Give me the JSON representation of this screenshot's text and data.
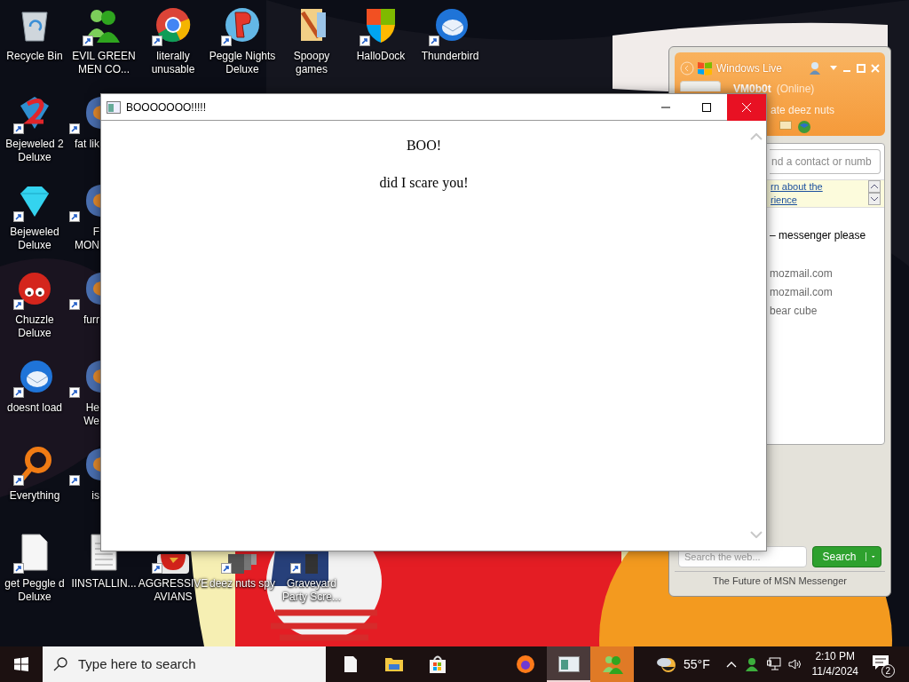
{
  "desktop": {
    "left_columns": [
      [
        {
          "lines": [
            "Recycle Bin"
          ],
          "shortcut": false
        },
        {
          "lines": [
            "Bejeweled 2",
            "Deluxe"
          ],
          "shortcut": true
        },
        {
          "lines": [
            "Bejeweled",
            "Deluxe"
          ],
          "shortcut": true
        },
        {
          "lines": [
            "Chuzzle",
            "Deluxe"
          ],
          "shortcut": true
        },
        {
          "lines": [
            "doesnt load"
          ],
          "shortcut": true
        },
        {
          "lines": [
            "Everything"
          ],
          "shortcut": true
        },
        {
          "lines": [
            "get Peggle d",
            "Deluxe"
          ],
          "shortcut": true
        }
      ],
      [
        {
          "lines": [
            "EVIL GREEN",
            "MEN CO..."
          ],
          "shortcut": true
        },
        {
          "lines": [
            "fat lik"
          ],
          "shortcut": true
        },
        {
          "lines": [
            "F",
            "MON"
          ],
          "shortcut": true
        },
        {
          "lines": [
            "furr"
          ],
          "shortcut": true
        },
        {
          "lines": [
            "He",
            "We"
          ],
          "shortcut": true
        },
        {
          "lines": [
            "is"
          ],
          "shortcut": true
        },
        {
          "lines": [
            "IINSTALLIN..."
          ],
          "shortcut": false
        }
      ]
    ],
    "top_row": [
      {
        "lines": [
          "literally",
          "unusable"
        ],
        "shortcut": true
      },
      {
        "lines": [
          "Peggle Nights",
          "Deluxe"
        ],
        "shortcut": true
      },
      {
        "lines": [
          "Spoopy",
          "games"
        ],
        "shortcut": false
      },
      {
        "lines": [
          "HalloDock"
        ],
        "shortcut": true
      },
      {
        "lines": [
          "Thunderbird"
        ],
        "shortcut": true
      }
    ],
    "bottom_row": [
      {
        "lines": [
          "AGGRESSIVE",
          "AVIANS"
        ],
        "shortcut": true
      },
      {
        "lines": [
          "deez nuts spy"
        ],
        "shortcut": true
      },
      {
        "lines": [
          "Graveyard",
          "Party Scre..."
        ],
        "shortcut": true
      }
    ]
  },
  "main_window": {
    "title": "BOOOOOOO!!!!!",
    "heading": "BOO!",
    "message": "did I scare you!"
  },
  "messenger": {
    "brand": "Windows Live",
    "user": "VM0b0t",
    "status": "(Online)",
    "personal_message": "ate deez nuts",
    "contact_search_placeholder": "nd a contact or numb",
    "info_link_lines": [
      "rn about the",
      "rience"
    ],
    "contacts": [
      {
        "text": "– messenger please"
      },
      {
        "text": "mozmail.com"
      },
      {
        "text": "mozmail.com"
      },
      {
        "text": "bear cube"
      }
    ],
    "web_search_placeholder": "Search the web...",
    "search_button": "Search",
    "footer": "The Future of MSN Messenger"
  },
  "taskbar": {
    "search_placeholder": "Type here to search",
    "pinned_apps": [
      {
        "active": false,
        "flashing": false
      },
      {
        "active": false,
        "flashing": false
      },
      {
        "active": false,
        "flashing": false
      }
    ],
    "running_apps": [
      {
        "active": false,
        "flashing": false
      },
      {
        "active": true,
        "flashing": false
      },
      {
        "active": false,
        "flashing": true
      }
    ],
    "temperature": "55°F",
    "time": "2:10 PM",
    "date": "11/4/2024",
    "notification_count": "2"
  }
}
